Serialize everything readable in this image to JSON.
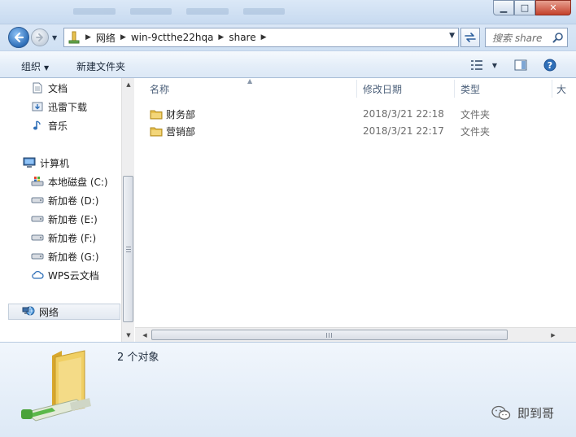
{
  "window": {
    "controls": {
      "minimize": "▁",
      "maximize": "□",
      "close": "✕"
    }
  },
  "address": {
    "breadcrumbs": [
      "网络",
      "win-9ctthe22hqa",
      "share"
    ]
  },
  "search": {
    "placeholder": "搜索 share"
  },
  "toolbar": {
    "organize_label": "组织",
    "new_folder_label": "新建文件夹"
  },
  "navigation": {
    "items": [
      {
        "label": "文档",
        "icon": "document-icon"
      },
      {
        "label": "迅雷下载",
        "icon": "download-icon"
      },
      {
        "label": "音乐",
        "icon": "music-icon"
      },
      {
        "label": "计算机",
        "icon": "computer-icon"
      },
      {
        "label": "本地磁盘 (C:)",
        "icon": "local-disk-icon"
      },
      {
        "label": "新加卷 (D:)",
        "icon": "drive-icon"
      },
      {
        "label": "新加卷 (E:)",
        "icon": "drive-icon"
      },
      {
        "label": "新加卷 (F:)",
        "icon": "drive-icon"
      },
      {
        "label": "新加卷 (G:)",
        "icon": "drive-icon"
      },
      {
        "label": "WPS云文档",
        "icon": "cloud-icon"
      },
      {
        "label": "网络",
        "icon": "network-icon",
        "selected": true
      }
    ]
  },
  "file_list": {
    "columns": [
      "名称",
      "修改日期",
      "类型",
      "大"
    ],
    "rows": [
      {
        "name": "财务部",
        "modified": "2018/3/21 22:18",
        "type": "文件夹"
      },
      {
        "name": "营销部",
        "modified": "2018/3/21 22:17",
        "type": "文件夹"
      }
    ]
  },
  "details": {
    "count_text": "2 个对象"
  },
  "watermark": {
    "text": "即到哥"
  },
  "colors": {
    "folder": "#e8c14e",
    "accent": "#2f6fb8",
    "window": "#cfe0f3"
  }
}
